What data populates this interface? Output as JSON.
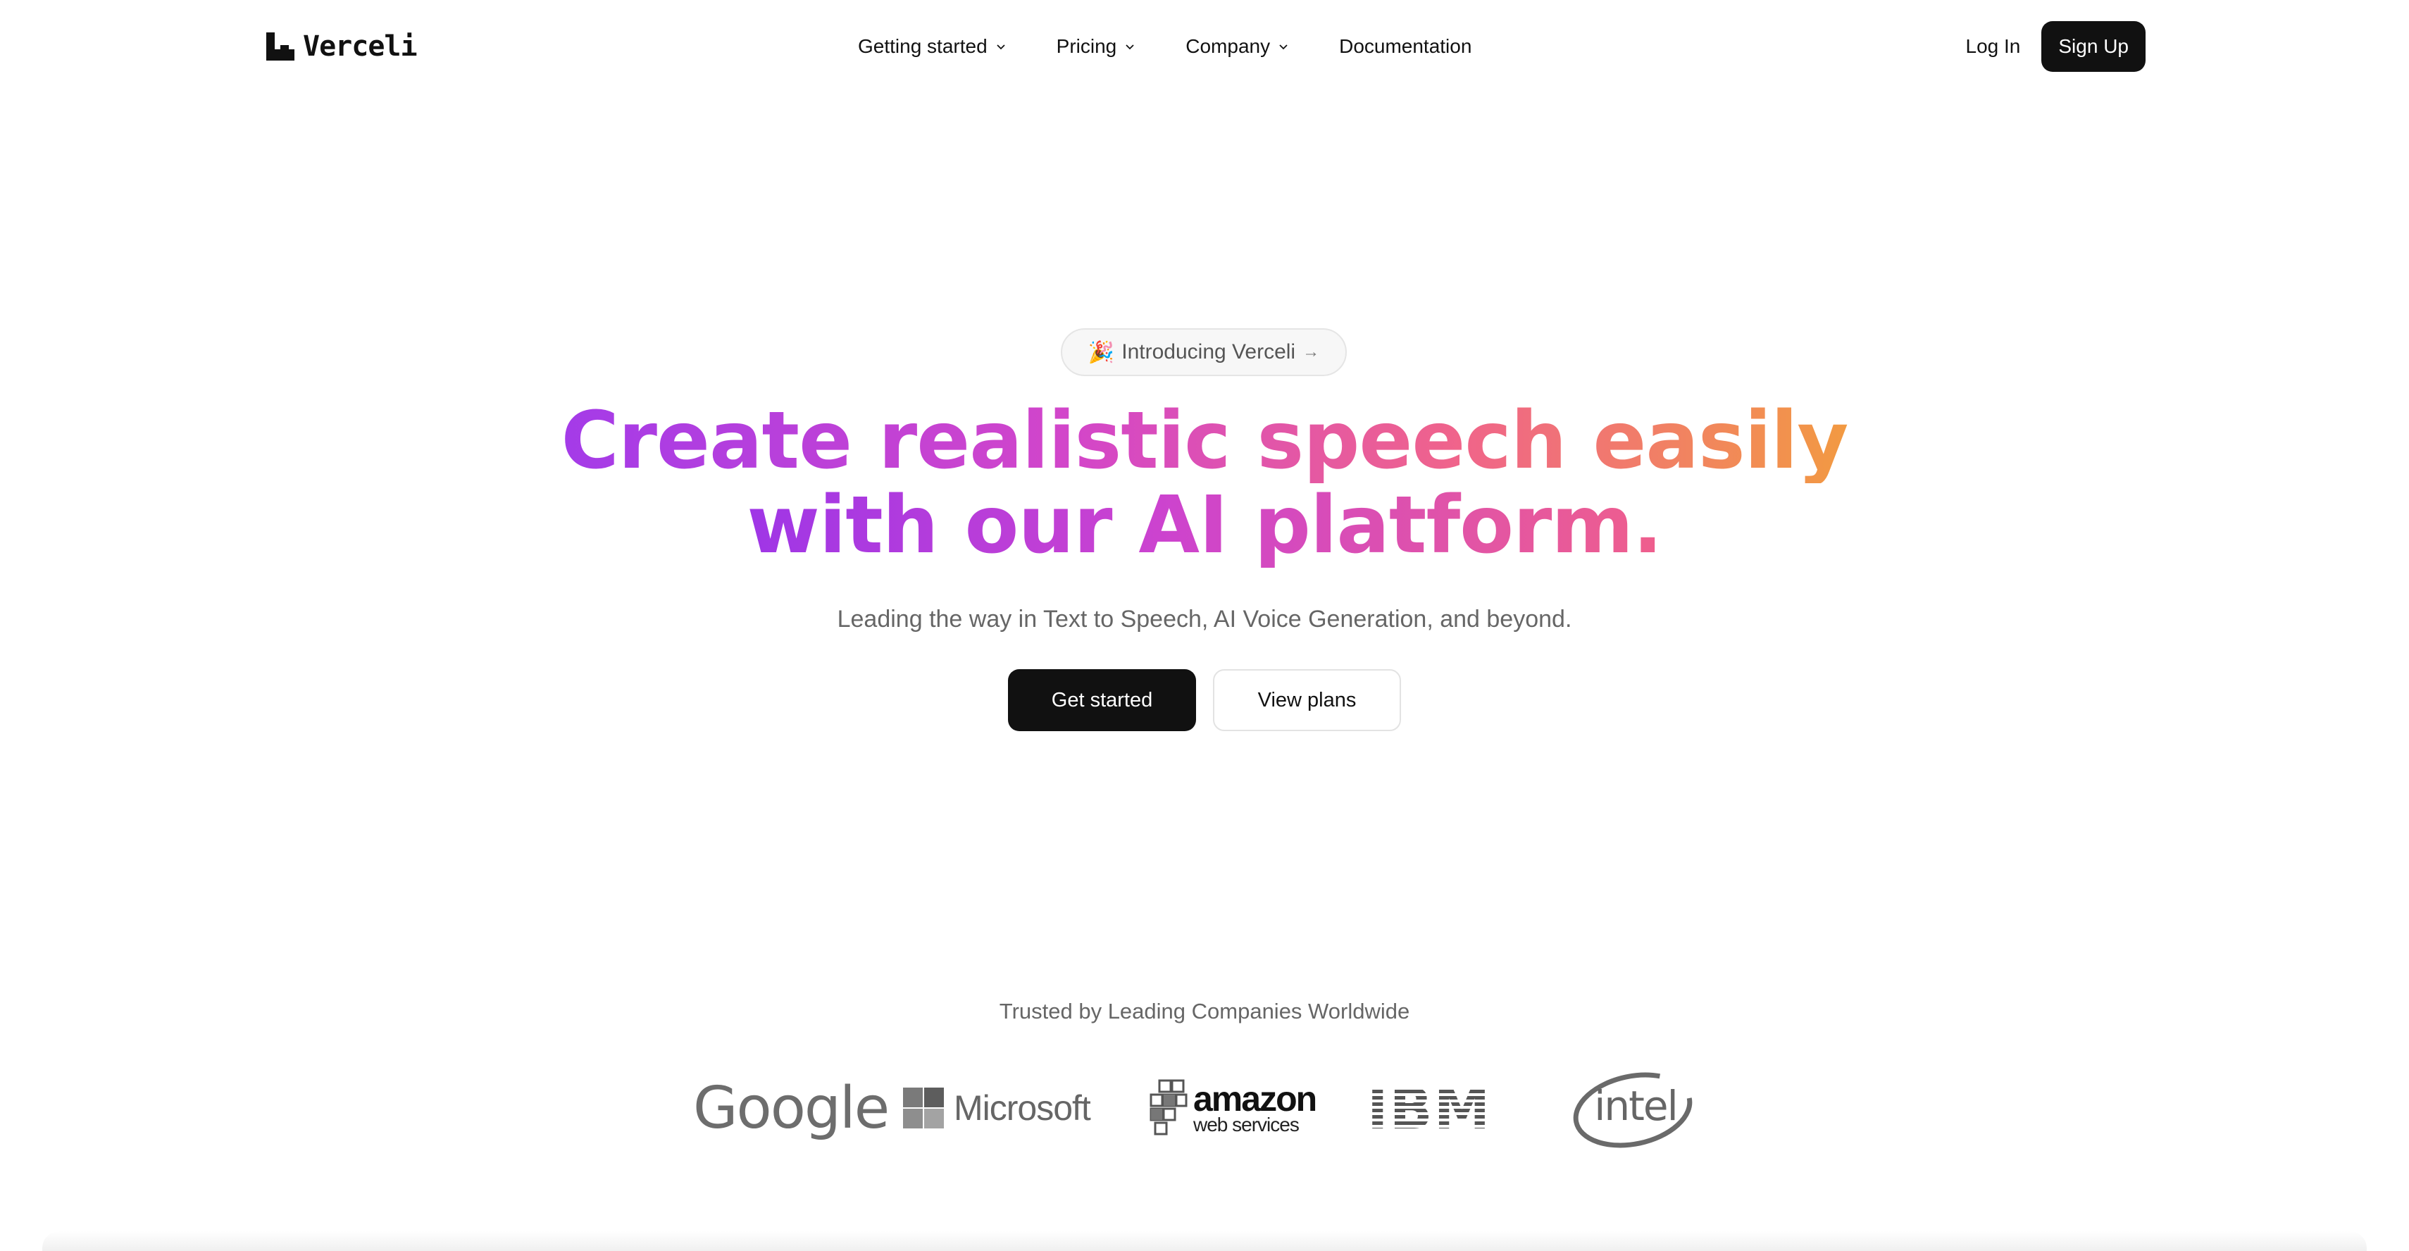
{
  "brand": {
    "name": "Verceli"
  },
  "nav": {
    "items": [
      {
        "label": "Getting started",
        "has_dropdown": true
      },
      {
        "label": "Pricing",
        "has_dropdown": true
      },
      {
        "label": "Company",
        "has_dropdown": true
      },
      {
        "label": "Documentation",
        "has_dropdown": false
      }
    ],
    "login_label": "Log In",
    "signup_label": "Sign Up"
  },
  "hero": {
    "badge": {
      "emoji": "🎉",
      "text": "Introducing Verceli",
      "arrow": "→"
    },
    "headline_line1": "Create realistic speech easily",
    "headline_line2": "with our AI platform.",
    "subtitle": "Leading the way in Text to Speech, AI Voice Generation, and beyond.",
    "primary_cta": "Get started",
    "secondary_cta": "View plans"
  },
  "trusted": {
    "heading": "Trusted by Leading Companies Worldwide",
    "logos": {
      "google": "Google",
      "microsoft": "Microsoft",
      "aws_line1": "amazon",
      "aws_line2": "web services",
      "ibm": "IBM",
      "intel": "intel"
    }
  },
  "colors": {
    "gradient_start": "#a43be8",
    "gradient_mid": "#f0648a",
    "gradient_end": "#f29a42",
    "button_dark": "#111111",
    "subtitle_gray": "#666666"
  }
}
